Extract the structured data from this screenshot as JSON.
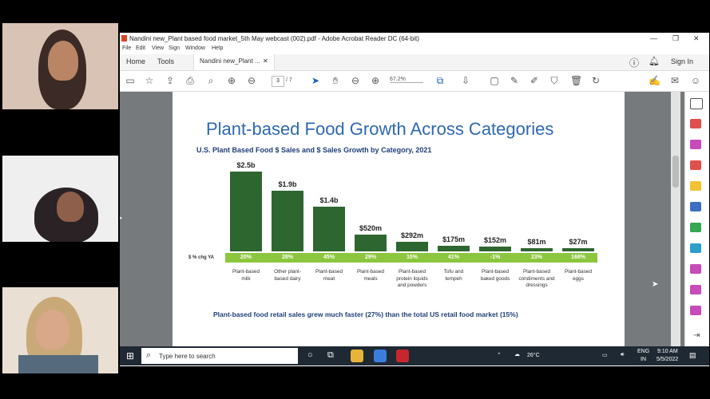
{
  "window": {
    "title": "Nandini new_Plant based food market_5th May webcast (002).pdf - Adobe Acrobat Reader DC (64-bit)",
    "menu": [
      "File",
      "Edit",
      "View",
      "Sign",
      "Window",
      "Help"
    ],
    "tabs": {
      "home": "Home",
      "tools": "Tools",
      "document": "Nandini new_Plant ..."
    },
    "sign_in": "Sign In",
    "page_current": "3",
    "page_total": "/ 7",
    "zoom": "67.2%"
  },
  "slide": {
    "title": "Plant-based Food Growth Across Categories",
    "subtitle": "U.S. Plant Based Food $ Sales and $ Sales Growth by Category, 2021",
    "pct_label": "$ % chg YA",
    "footnote": "Plant-based food retail sales grew much faster (27%) than the total US retail food market (15%)"
  },
  "chart_data": {
    "type": "bar",
    "title": "U.S. Plant Based Food $ Sales and $ Sales Growth by Category, 2021",
    "categories": [
      [
        "Plant-based",
        "milk"
      ],
      [
        "Other plant-",
        "based dairy"
      ],
      [
        "Plant-based",
        "meat"
      ],
      [
        "Plant-based",
        "meals"
      ],
      [
        "Plant-based",
        "protein liquids",
        "and powders"
      ],
      [
        "Tofu and",
        "tempeh"
      ],
      [
        "Plant-based",
        "baked goods"
      ],
      [
        "Plant-based",
        "condiments and",
        "dressings"
      ],
      [
        "Plant-based",
        "eggs"
      ]
    ],
    "values_musd": [
      2500,
      1900,
      1400,
      520,
      292,
      175,
      152,
      81,
      27
    ],
    "value_labels": [
      "$2.5b",
      "$1.9b",
      "$1.4b",
      "$520m",
      "$292m",
      "$175m",
      "$152m",
      "$81m",
      "$27m"
    ],
    "pct_chg": [
      "20%",
      "28%",
      "45%",
      "29%",
      "10%",
      "41%",
      "-1%",
      "23%",
      "168%"
    ],
    "colors": {
      "bar": "#2e6630",
      "strip": "#8cc63f"
    }
  },
  "taskbar": {
    "search_placeholder": "Type here to search",
    "temperature": "26°C",
    "lang": "ENG",
    "region": "IN",
    "time": "9:10 AM",
    "date": "5/5/2022"
  }
}
